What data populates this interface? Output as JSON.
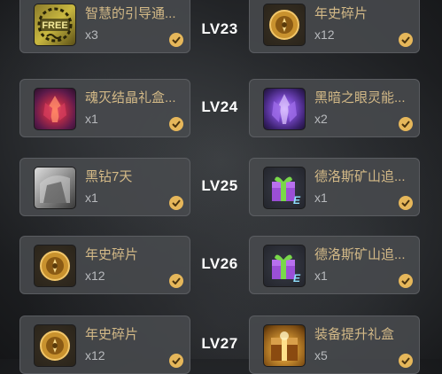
{
  "colors": {
    "item_name": "#d3b987",
    "quantity": "#b8babd",
    "level": "#ffffff",
    "check": "#e6b75a",
    "card_bg": "#484a4d"
  },
  "rows": [
    {
      "level": "LV23",
      "left": {
        "name": "智慧的引导通...",
        "qty": "x3",
        "icon": "free-guide-icon",
        "icon_text": "FREE",
        "claimed": true
      },
      "right": {
        "name": "年史碎片",
        "qty": "x12",
        "icon": "chronicle-fragment-icon",
        "claimed": true
      }
    },
    {
      "level": "LV24",
      "left": {
        "name": "魂灭结晶礼盒...",
        "qty": "x1",
        "icon": "soul-crystal-box-icon",
        "claimed": true
      },
      "right": {
        "name": "黑暗之眼灵能...",
        "qty": "x2",
        "icon": "dark-eye-crystal-icon",
        "claimed": true
      }
    },
    {
      "level": "LV25",
      "left": {
        "name": "黑钻7天",
        "qty": "x1",
        "icon": "black-diamond-icon",
        "claimed": true
      },
      "right": {
        "name": "德洛斯矿山追...",
        "qty": "x1",
        "icon": "gift-box-icon",
        "claimed": true
      }
    },
    {
      "level": "LV26",
      "left": {
        "name": "年史碎片",
        "qty": "x12",
        "icon": "chronicle-fragment-icon",
        "claimed": true
      },
      "right": {
        "name": "德洛斯矿山追...",
        "qty": "x1",
        "icon": "gift-box-icon",
        "claimed": true
      }
    },
    {
      "level": "LV27",
      "left": {
        "name": "年史碎片",
        "qty": "x12",
        "icon": "chronicle-fragment-icon",
        "claimed": true
      },
      "right": {
        "name": "装备提升礼盒",
        "qty": "x5",
        "icon": "equipment-upgrade-box-icon",
        "claimed": true
      }
    }
  ]
}
